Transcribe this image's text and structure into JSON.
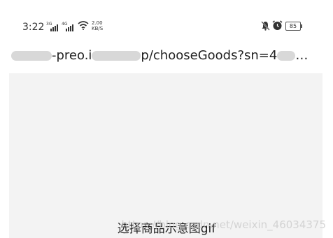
{
  "status_bar": {
    "time": "3:22",
    "network_1": "3G",
    "network_2": "4G",
    "net_speed_value": "2.00",
    "net_speed_unit": "KB/S",
    "battery": "85",
    "icons": [
      "signal-icon",
      "signal-icon",
      "wifi-icon",
      "mute-icon",
      "alarm-icon",
      "battery-icon"
    ]
  },
  "address_bar": {
    "url_part_1": "-preo.i",
    "url_part_2": "p/chooseGoods?sn=4",
    "url_ellipsis": "…"
  },
  "caption": "选择商品示意图gif",
  "watermark": "https://blog.csdn.net/weixin_46034375"
}
